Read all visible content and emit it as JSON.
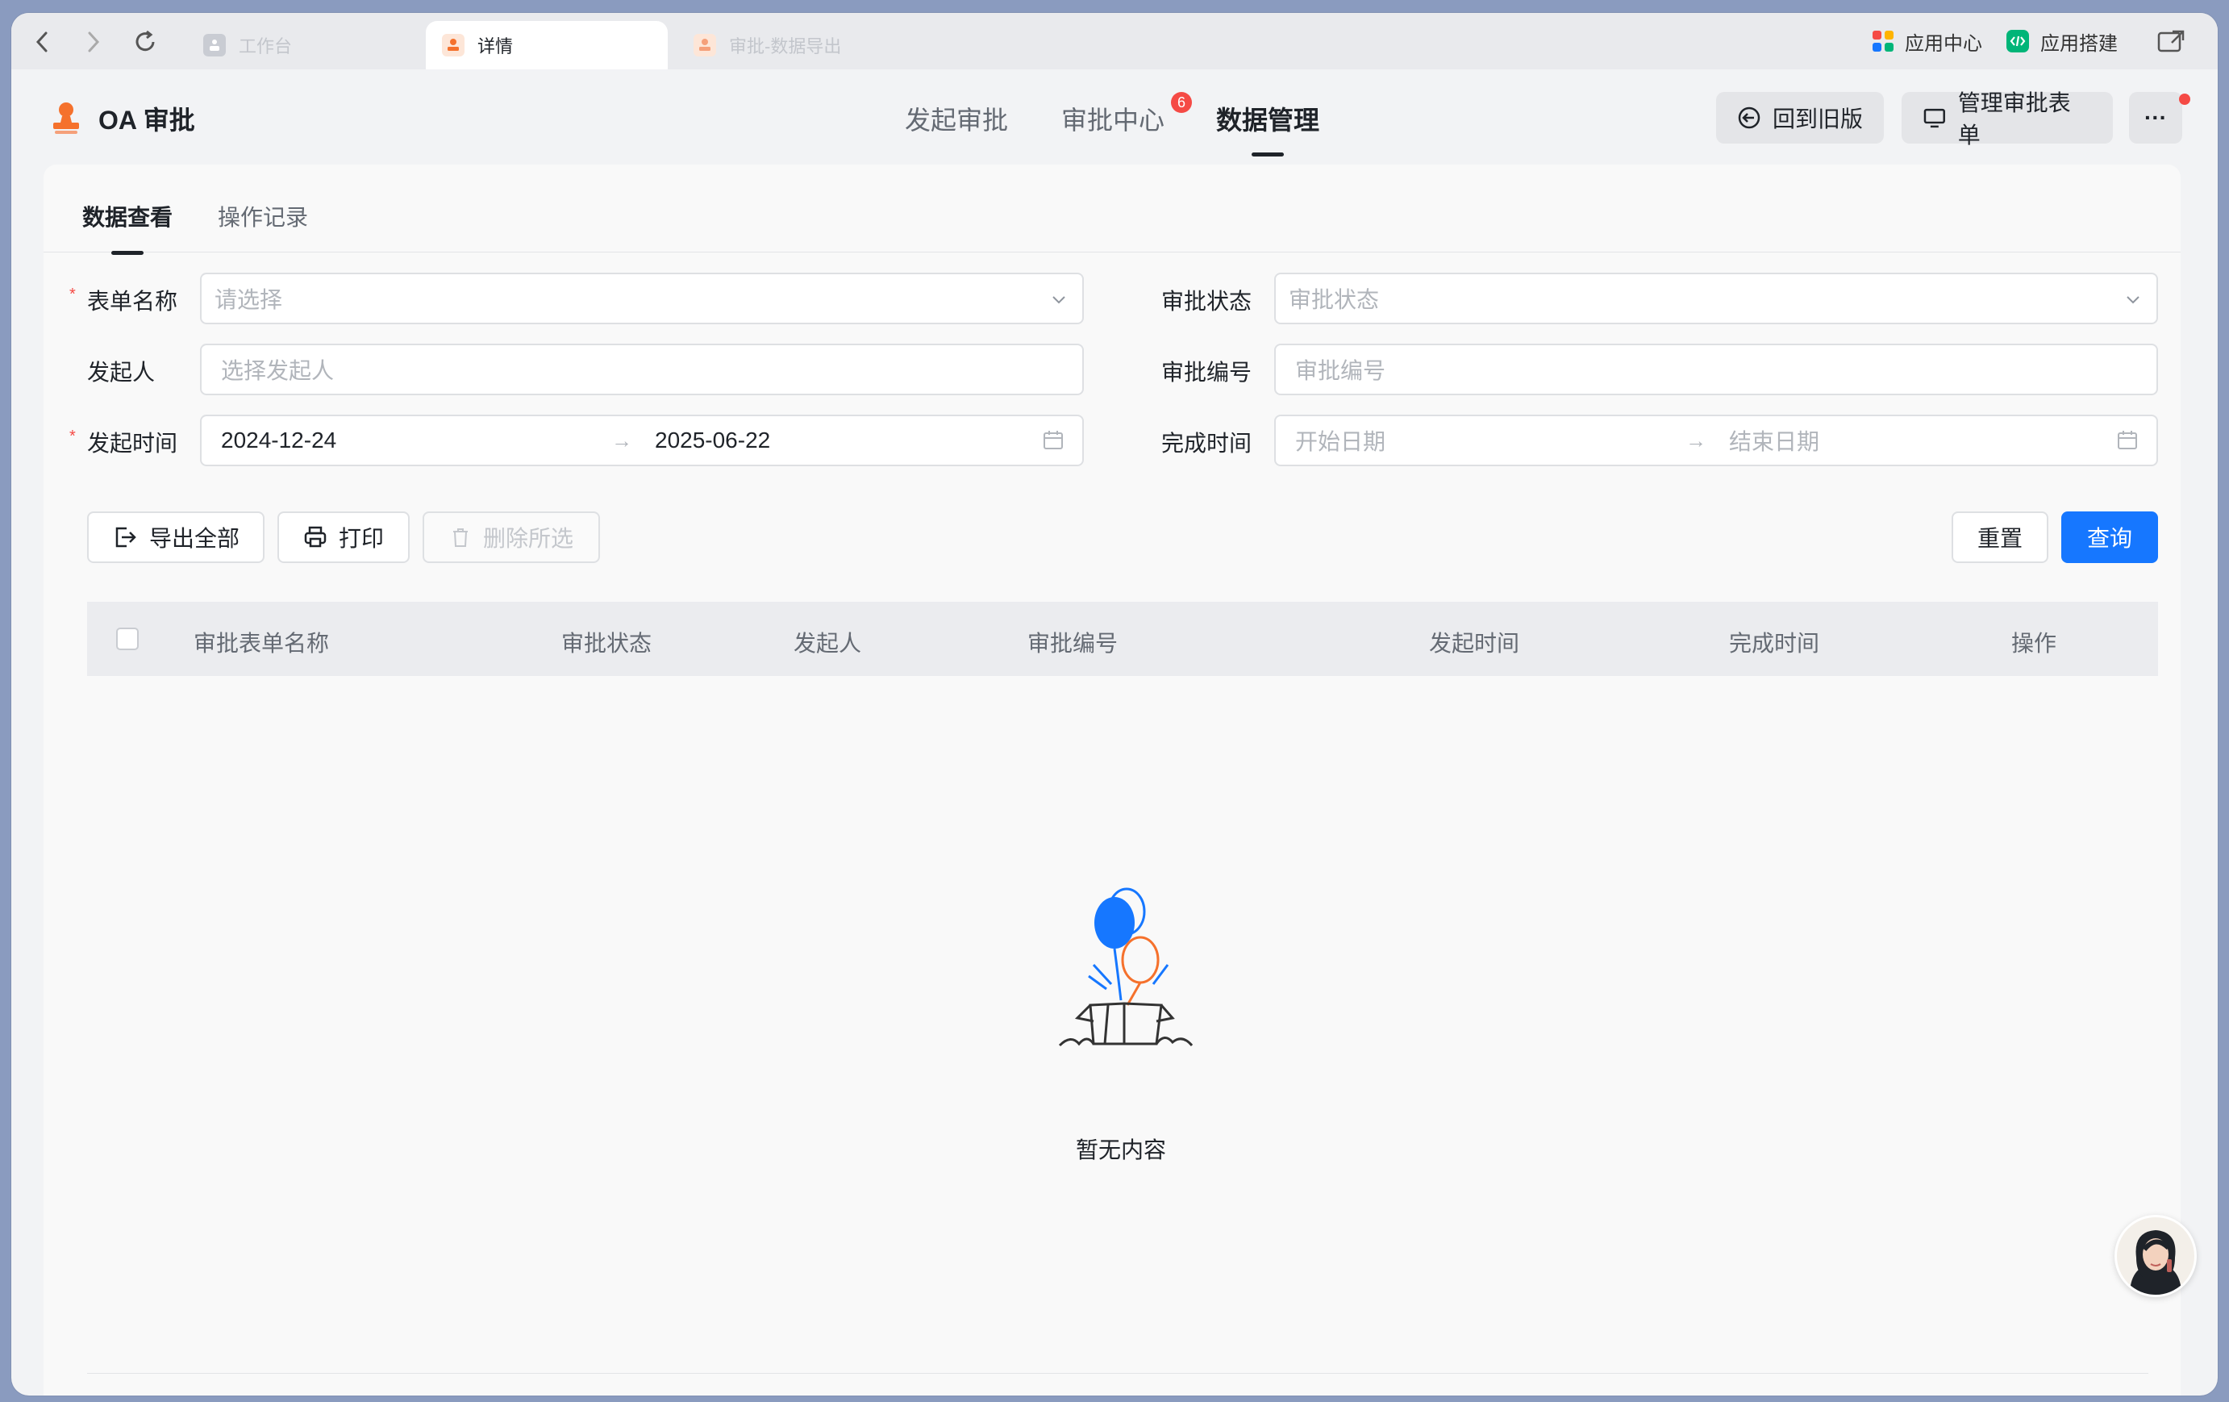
{
  "browser": {
    "tabs": [
      {
        "label": "工作台"
      },
      {
        "label": "详情"
      },
      {
        "label": "审批-数据导出"
      }
    ],
    "right_links": {
      "app_center": "应用中心",
      "app_builder": "应用搭建"
    }
  },
  "header": {
    "app_title": "OA 审批",
    "nav": [
      {
        "label": "发起审批"
      },
      {
        "label": "审批中心",
        "badge": "6"
      },
      {
        "label": "数据管理"
      }
    ],
    "back_old_label": "回到旧版",
    "manage_forms_label": "管理审批表单",
    "more_label": "···"
  },
  "subtabs": [
    {
      "label": "数据查看"
    },
    {
      "label": "操作记录"
    }
  ],
  "filters": {
    "form_name": {
      "label": "表单名称",
      "placeholder": "请选择"
    },
    "status": {
      "label": "审批状态",
      "placeholder": "审批状态"
    },
    "initiator": {
      "label": "发起人",
      "placeholder": "选择发起人"
    },
    "number": {
      "label": "审批编号",
      "placeholder": "审批编号"
    },
    "start_time": {
      "label": "发起时间",
      "from": "2024-12-24",
      "to": "2025-06-22"
    },
    "finish_time": {
      "label": "完成时间",
      "from_placeholder": "开始日期",
      "to_placeholder": "结束日期"
    }
  },
  "actions": {
    "export_all": "导出全部",
    "print": "打印",
    "delete_selected": "删除所选",
    "reset": "重置",
    "query": "查询"
  },
  "table": {
    "columns": [
      "审批表单名称",
      "审批状态",
      "发起人",
      "审批编号",
      "发起时间",
      "完成时间",
      "操作"
    ],
    "empty_text": "暂无内容"
  },
  "colors": {
    "primary": "#1677ff",
    "badge": "#f54a45",
    "accent_orange": "#f5712c"
  }
}
